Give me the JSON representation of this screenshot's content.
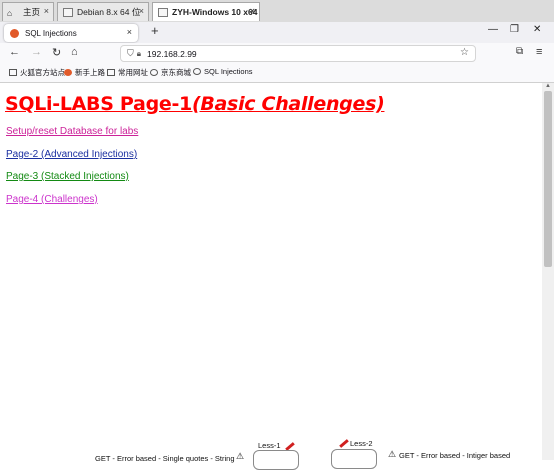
{
  "vm_tabs": [
    {
      "label": "主页",
      "active": false
    },
    {
      "label": "Debian 8.x 64 位",
      "active": false
    },
    {
      "label": "ZYH-Windows 10 x64",
      "active": true
    }
  ],
  "browser": {
    "tab_title": "SQL Injections",
    "url": "192.168.2.99",
    "bookmarks": [
      "火狐官方站点",
      "新手上路",
      "常用网址",
      "京东商城",
      "SQL Injections"
    ]
  },
  "page": {
    "title_main": "SQLi-LABS Page-1",
    "title_sub": "(Basic Challenges)",
    "links": [
      {
        "label": "Setup/reset Database for labs",
        "color": "#cc2299"
      },
      {
        "label": "Page-2 (Advanced Injections)",
        "color": "#1a2fa0"
      },
      {
        "label": "Page-3 (Stacked Injections)",
        "color": "#138a13"
      },
      {
        "label": "Page-4 (Challenges)",
        "color": "#cc33cc"
      }
    ],
    "bottom": {
      "less1": "Less-1",
      "less2": "Less-2",
      "left_text": "GET - Error based - Single quotes - String",
      "right_text": "GET - Error based - Intiger based"
    }
  },
  "colors": {
    "title": "#ff0000",
    "accent": "#e15a2a"
  }
}
